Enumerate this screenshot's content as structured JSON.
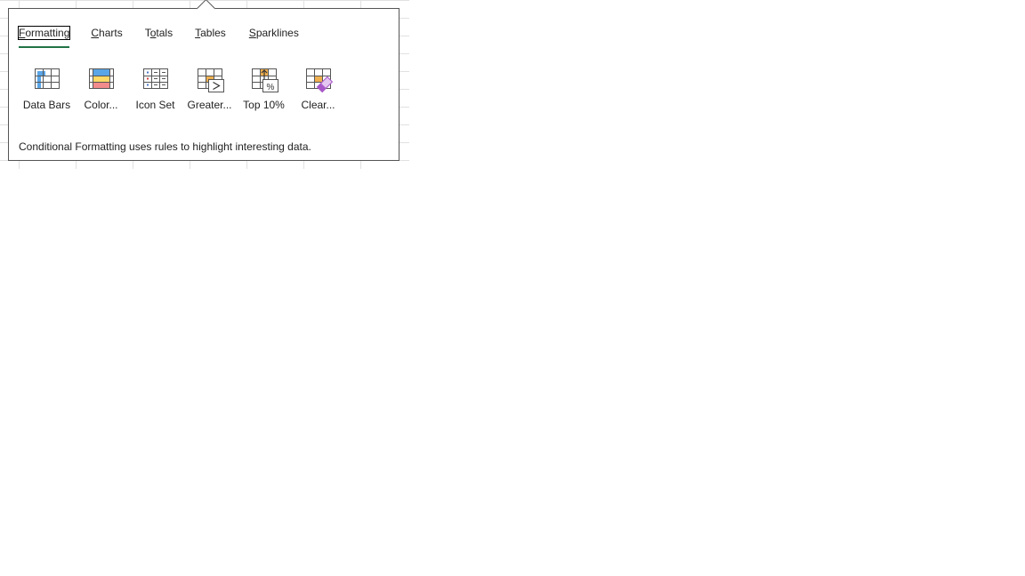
{
  "tabs": [
    {
      "pre": "",
      "acc": "F",
      "post": "ormatting",
      "active": true
    },
    {
      "pre": "",
      "acc": "C",
      "post": "harts",
      "active": false
    },
    {
      "pre": "T",
      "acc": "o",
      "post": "tals",
      "active": false
    },
    {
      "pre": "",
      "acc": "T",
      "post": "ables",
      "active": false
    },
    {
      "pre": "",
      "acc": "S",
      "post": "parklines",
      "active": false
    }
  ],
  "tools": [
    {
      "label": "Data Bars",
      "icon": "data-bars-icon"
    },
    {
      "label": "Color...",
      "icon": "color-scale-icon"
    },
    {
      "label": "Icon Set",
      "icon": "icon-set-icon"
    },
    {
      "label": "Greater...",
      "icon": "greater-than-icon"
    },
    {
      "label": "Top 10%",
      "icon": "top-ten-percent-icon"
    },
    {
      "label": "Clear...",
      "icon": "clear-format-icon"
    }
  ],
  "description": "Conditional Formatting uses rules to highlight interesting data.",
  "colors": {
    "accent": "#217346",
    "gridline": "#e1e1e1",
    "bar_blue": "#5aa5e6",
    "scale_yellow": "#ffd966",
    "scale_red": "#f28b8b",
    "arrow_orange": "#f0b050",
    "eraser_purple": "#a857c8"
  }
}
